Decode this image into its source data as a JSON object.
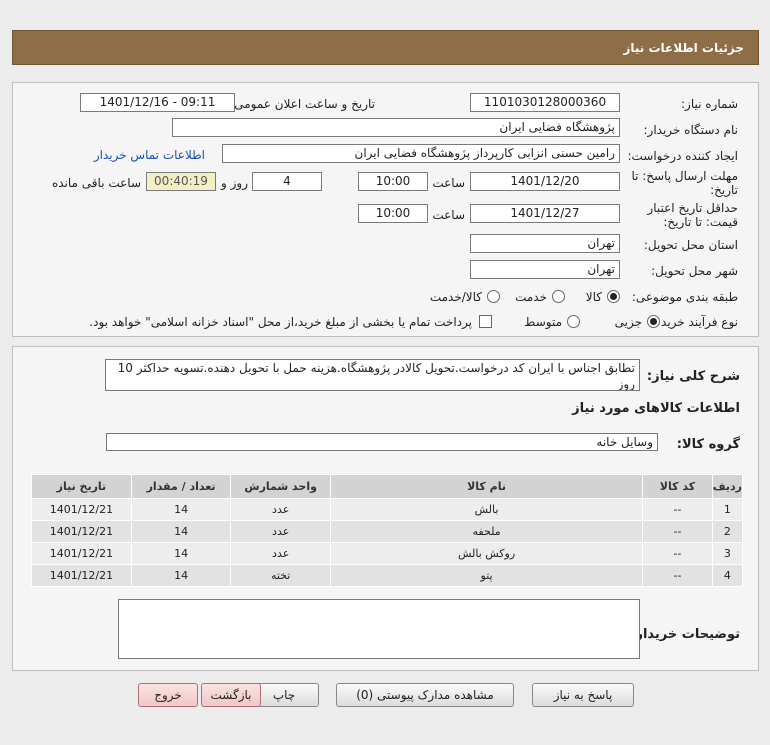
{
  "header": {
    "title": "جزئیات اطلاعات نیاز"
  },
  "form": {
    "need_number_label": "شماره نیاز:",
    "need_number": "1101030128000360",
    "announce_label": "تاریخ و ساعت اعلان عمومی:",
    "announce_value": "1401/12/16 - 09:11",
    "buyer_org_label": "نام دستگاه خریدار:",
    "buyer_org": "پژوهشگاه فضایی ایران",
    "requester_label": "ایجاد کننده درخواست:",
    "requester": "رامین حسنی انزابی کارپرداز پژوهشگاه فضایی ایران",
    "contact_link": "اطلاعات تماس خریدار",
    "reply_deadline_label_1": "مهلت ارسال پاسخ: تا",
    "reply_deadline_label_2": "تاریخ:",
    "reply_date": "1401/12/20",
    "time_label": "ساعت",
    "reply_time": "10:00",
    "days_value": "4",
    "days_label": "روز و",
    "remaining_time": "00:40:19",
    "remaining_label": "ساعت باقی مانده",
    "validity_label_1": "حداقل تاریخ اعتبار",
    "validity_label_2": "قیمت: تا تاریخ:",
    "validity_date": "1401/12/27",
    "validity_time": "10:00",
    "province_label": "استان محل تحویل:",
    "province": "تهران",
    "city_label": "شهر محل تحویل:",
    "city": "تهران",
    "category_label": "طبقه بندی موضوعی:",
    "category_options": [
      "کالا",
      "خدمت",
      "کالا/خدمت"
    ],
    "category_selected": "کالا",
    "process_label": "نوع فرآیند خرید :",
    "process_options": [
      "جزیی",
      "متوسط"
    ],
    "process_selected": "جزیی",
    "payment_note": "پرداخت تمام یا بخشی از مبلغ خرید،از محل \"اسناد خزانه اسلامی\" خواهد بود."
  },
  "details": {
    "description_label": "شرح کلی نیاز:",
    "description": "تطابق اجناس با ایران کد درخواست.تحویل کالادر پژوهشگاه.هزینه حمل با تحویل دهنده.تسویه حداکثر 10 روز",
    "goods_info_title": "اطلاعات کالاهای مورد نیاز",
    "goods_group_label": "گروه کالا:",
    "goods_group": "وسایل خانه",
    "table": {
      "headers": [
        "ردیف",
        "کد کالا",
        "نام کالا",
        "واحد شمارش",
        "تعداد / مقدار",
        "تاریخ نیاز"
      ],
      "rows": [
        [
          "1",
          "--",
          "بالش",
          "عدد",
          "14",
          "1401/12/21"
        ],
        [
          "2",
          "--",
          "ملحفه",
          "عدد",
          "14",
          "1401/12/21"
        ],
        [
          "3",
          "--",
          "روکش بالش",
          "عدد",
          "14",
          "1401/12/21"
        ],
        [
          "4",
          "--",
          "پتو",
          "تخته",
          "14",
          "1401/12/21"
        ]
      ]
    },
    "buyer_notes_label": "توضیحات خریدار:",
    "buyer_notes": ""
  },
  "buttons": {
    "reply": "پاسخ به نیاز",
    "attachments": "مشاهده مدارک پیوستی (0)",
    "print": "چاپ",
    "back": "بازگشت",
    "exit": "خروج"
  }
}
